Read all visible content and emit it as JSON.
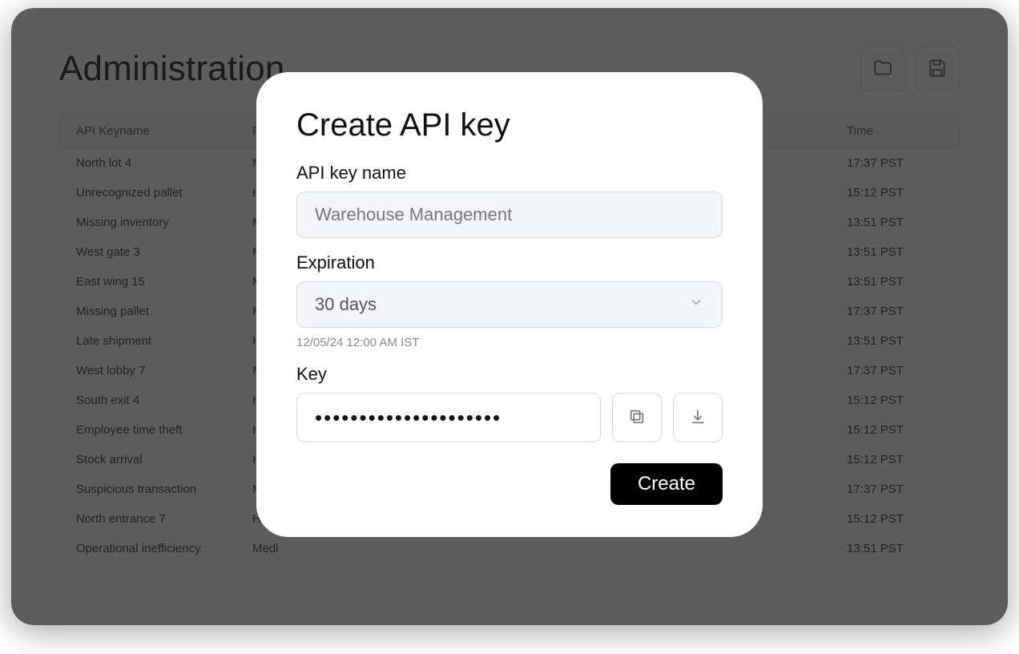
{
  "page": {
    "title": "Administration"
  },
  "table": {
    "headers": {
      "keyname": "API Keyname",
      "priority": "Pr",
      "time": "Time"
    },
    "rows": [
      {
        "keyname": "North lot 4",
        "priority": "M",
        "time": "17:37 PST"
      },
      {
        "keyname": "Unrecognized pallet",
        "priority": "H",
        "time": "15:12 PST"
      },
      {
        "keyname": "Missing inventory",
        "priority": "M",
        "time": "13:51 PST"
      },
      {
        "keyname": "West gate 3",
        "priority": "M",
        "time": "13:51 PST"
      },
      {
        "keyname": "East wing 15",
        "priority": "M",
        "time": "13:51 PST"
      },
      {
        "keyname": "Missing pallet",
        "priority": "M",
        "time": "17:37 PST"
      },
      {
        "keyname": "Late shipment",
        "priority": "H",
        "time": "13:51 PST"
      },
      {
        "keyname": "West lobby 7",
        "priority": "M",
        "time": "17:37 PST"
      },
      {
        "keyname": "South exit 4",
        "priority": "H",
        "time": "15:12 PST"
      },
      {
        "keyname": "Employee time theft",
        "priority": "H",
        "time": "15:12 PST"
      },
      {
        "keyname": "Stock arrival",
        "priority": "H",
        "time": "15:12 PST"
      },
      {
        "keyname": "Suspicious transaction",
        "priority": "M",
        "time": "17:37 PST"
      },
      {
        "keyname": "North entrance 7",
        "priority": "H",
        "time": "15:12 PST"
      },
      {
        "keyname": "Operational inefficiency",
        "priority": "Medi",
        "time": "13:51 PST"
      }
    ]
  },
  "modal": {
    "title": "Create API key",
    "name_label": "API key name",
    "name_value": "Warehouse Management",
    "expiration_label": "Expiration",
    "expiration_value": "30 days",
    "expiration_helper": "12/05/24 12:00 AM IST",
    "key_label": "Key",
    "key_mask": "•••••••••••••••••••••",
    "create_label": "Create"
  }
}
